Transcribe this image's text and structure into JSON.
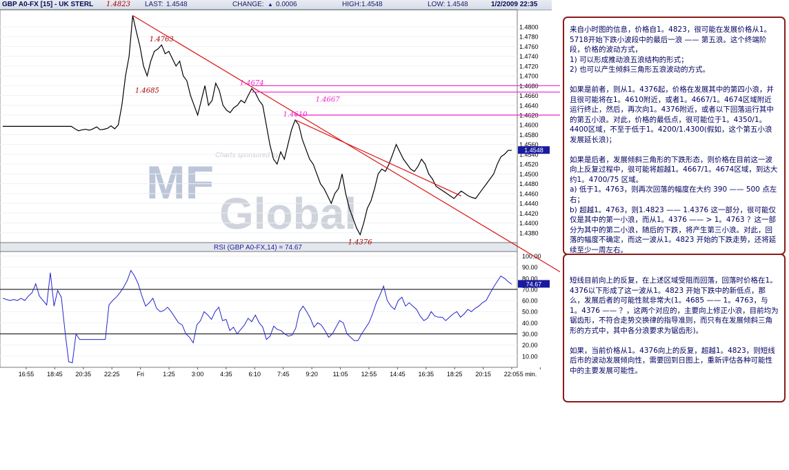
{
  "header": {
    "symbol": "GBP A0-FX [15] - UK STERL",
    "title_high": "1.4823",
    "last_label": "LAST:",
    "last_value": "1.4548",
    "change_label": "CHANGE:",
    "change_arrow": "▲",
    "change_value": "0.0006",
    "high_label": "HIGH:",
    "high_value": "1.4548",
    "low_label": "LOW:",
    "low_value": "1.4548",
    "datetime": "1/2/2009 22:35"
  },
  "colors": {
    "price": "#000000",
    "rsi": "#2222cc",
    "trendline": "#dd1111",
    "resistance": "#ee22cc",
    "annotation_red": "#aa0000",
    "annotation_magenta": "#ee22cc",
    "last_tag_bg": "#1a1aa0",
    "note_border": "#8b1a1a",
    "note_text": "#000060"
  },
  "watermark": {
    "sponsor": "Charts sponsored by",
    "logo_mf": "MF",
    "logo_global": "Global"
  },
  "chart_data": [
    {
      "type": "line",
      "panel": "price",
      "ylim": [
        1.436,
        1.4835
      ],
      "y_ticks": [
        "1.4800",
        "1.4780",
        "1.4760",
        "1.4740",
        "1.4720",
        "1.4700",
        "1.4680",
        "1.4660",
        "1.4640",
        "1.4620",
        "1.4600",
        "1.4580",
        "1.4560",
        "1.4540",
        "1.4520",
        "1.4500",
        "1.4480",
        "1.4460",
        "1.4440",
        "1.4420",
        "1.4400",
        "1.4380"
      ],
      "x_ticks": [
        "16:55",
        "18:45",
        "20:35",
        "22:25",
        "Fri",
        "1:25",
        "3:00",
        "4:35",
        "6:10",
        "7:45",
        "9:20",
        "11:05",
        "12:55",
        "14:45",
        "16:35",
        "18:25",
        "20:15",
        "22:05",
        "5 min."
      ],
      "last_price": "1.4548",
      "series": [
        {
          "values": [
            1.4597,
            1.4597,
            1.4597,
            1.4597,
            1.4597,
            1.4597,
            1.4597,
            1.4597,
            1.4597,
            1.4597,
            1.4597,
            1.4597,
            1.4597,
            1.4597,
            1.4597,
            1.4597,
            1.4597,
            1.4597,
            1.4597,
            1.4597,
            1.4592,
            1.4588,
            1.459,
            1.4591,
            1.4589,
            1.4592,
            1.4596,
            1.459,
            1.4591,
            1.4593,
            1.4598,
            1.4592,
            1.46,
            1.464,
            1.47,
            1.474,
            1.4823,
            1.479,
            1.476,
            1.472,
            1.47,
            1.473,
            1.475,
            1.4755,
            1.4763,
            1.4745,
            1.475,
            1.4735,
            1.472,
            1.473,
            1.47,
            1.469,
            1.466,
            1.464,
            1.462,
            1.465,
            1.468,
            1.464,
            1.465,
            1.4685,
            1.467,
            1.464,
            1.463,
            1.4625,
            1.4635,
            1.464,
            1.465,
            1.4645,
            1.466,
            1.4674,
            1.4665,
            1.465,
            1.464,
            1.46,
            1.456,
            1.453,
            1.452,
            1.4545,
            1.453,
            1.456,
            1.459,
            1.461,
            1.46,
            1.457,
            1.455,
            1.453,
            1.452,
            1.45,
            1.448,
            1.447,
            1.4455,
            1.444,
            1.446,
            1.447,
            1.45,
            1.446,
            1.443,
            1.441,
            1.439,
            1.4376,
            1.44,
            1.443,
            1.4445,
            1.447,
            1.45,
            1.451,
            1.4505,
            1.452,
            1.454,
            1.456,
            1.4545,
            1.453,
            1.452,
            1.451,
            1.4505,
            1.4515,
            1.453,
            1.452,
            1.45,
            1.449,
            1.4475,
            1.447,
            1.4465,
            1.446,
            1.4455,
            1.445,
            1.4458,
            1.4465,
            1.446,
            1.4455,
            1.4452,
            1.445,
            1.446,
            1.447,
            1.448,
            1.449,
            1.45,
            1.452,
            1.4535,
            1.454,
            1.4548,
            1.4548
          ],
          "name": ""
        }
      ],
      "annotations": [
        {
          "text": "1.4823",
          "x_index": 36,
          "y": 1.4823,
          "color": "red"
        },
        {
          "text": "1.4763",
          "x_index": 44,
          "y": 1.4763,
          "color": "red"
        },
        {
          "text": "1.4685",
          "x_index": 40,
          "y": 1.4685,
          "color": "red"
        },
        {
          "text": "1.4674",
          "x_index": 69,
          "y": 1.4674,
          "color": "magenta"
        },
        {
          "text": "1.4667",
          "x_index": 90,
          "y": 1.4667,
          "color": "magenta"
        },
        {
          "text": "1.4610",
          "x_index": 81,
          "y": 1.461,
          "color": "magenta"
        },
        {
          "text": "1.4376",
          "x_index": 99,
          "y": 1.4376,
          "color": "red"
        }
      ],
      "trendlines": [
        {
          "from_index": 36,
          "from_y": 1.4823,
          "to": "note-2",
          "color": "red"
        },
        {
          "from_index": 81,
          "from_y": 1.461,
          "to_index": 127,
          "to_y": 1.4455,
          "color": "red"
        }
      ],
      "horizontal_lines": [
        {
          "y": 1.468,
          "from_index": 69,
          "color": "magenta"
        },
        {
          "y": 1.4667,
          "from_index": 69,
          "color": "magenta"
        },
        {
          "y": 1.462,
          "from_index": 81,
          "color": "magenta"
        }
      ]
    },
    {
      "type": "line",
      "panel": "rsi",
      "title": "RSI (GBP A0-FX,14) = 74.67",
      "ylim": [
        0,
        104
      ],
      "y_ticks": [
        "100.00",
        "90.00",
        "80.00",
        "70.00",
        "60.00",
        "50.00",
        "40.00",
        "30.00",
        "20.00",
        "10.00"
      ],
      "reference_lines": [
        70,
        30
      ],
      "last_value": "74.67",
      "series": [
        {
          "values": [
            62,
            61,
            60,
            61,
            60,
            62,
            60,
            64,
            67,
            75,
            64,
            60,
            56,
            85,
            55,
            69,
            63,
            32,
            5,
            4,
            30,
            25,
            25,
            25,
            25,
            25,
            25,
            25,
            25,
            56,
            60,
            63,
            67,
            72,
            78,
            87,
            82,
            75,
            64,
            55,
            58,
            62,
            53,
            50,
            51,
            54,
            50,
            45,
            40,
            38,
            30,
            27,
            22,
            38,
            42,
            50,
            47,
            43,
            50,
            54,
            42,
            43,
            33,
            36,
            30,
            34,
            38,
            44,
            41,
            47,
            40,
            36,
            25,
            28,
            37,
            34,
            33,
            30,
            28,
            29,
            35,
            50,
            55,
            50,
            44,
            36,
            40,
            38,
            33,
            27,
            30,
            36,
            42,
            40,
            30,
            27,
            24,
            24,
            30,
            35,
            40,
            48,
            58,
            65,
            73,
            60,
            55,
            52,
            60,
            63,
            55,
            58,
            55,
            52,
            46,
            42,
            44,
            50,
            46,
            45,
            45,
            42,
            45,
            48,
            50,
            45,
            48,
            52,
            50,
            53,
            55,
            58,
            60,
            66,
            72,
            77,
            82,
            80,
            77,
            74.67
          ],
          "name": ""
        }
      ]
    }
  ],
  "notes": [
    {
      "paragraphs": [
        "来自小时图的信息，价格自1。4823，很可能在发展价格从1。5718开始下跌小波段中的最后一浪 —— 第五浪。这个终端阶段，价格的波动方式，",
        "1) 可以形成推动浪五浪结构的形式；",
        "2) 也可以产生倾斜三角形五浪波动的方式。",
        "",
        "如果是前者，则从1。4376起，价格在发展其中的第四小浪，并且很可能将在1。4610附近，或者1。4667/1。4674区域附近运行终止，然后，再次向1。4376附近，或者以下回落运行其中的第五小浪。对此，价格的最低点，很可能位于1。4350/1。4400区域，不至于低于1。4200/1.4300(假如，这个第五小浪发展延长浪)；",
        "",
        "如果是后者，发展倾斜三角形的下跌形态，则价格在目前这一波向上反复过程中，很可能将超越1。4667/1。4674区域，到达大约1。4700/75 区域。",
        "a) 低于1。4763，则再次回落的幅度在大约 390 —— 500 点左右；",
        "b) 超越1。4763，则1.4823 —— 1.4376 这一部分，很可能仅仅是其中的第一小浪，而从1。4376 —— > 1。4763 ？这一部分为其中的第二小浪，随后的下跌，将产生第三小浪。对此，回落的幅度不确定，而这一波从1。4823 开始的下跌走势，还将延续至少一周左右。"
      ]
    },
    {
      "paragraphs": [
        "短线目前向上的反复，在上述区域受阻而回落，回落时价格在1。4376以下形成了这一波从1。4823 开始下跌中的新低点，那么，发展后者的可能性就非常大(1。4685 —— 1。4763，与 1。4376 —— ？，这两个对应的，主要向上修正小浪，目前均为锯齿形，不符合走势交换律的指导准则，而只有在发展倾斜三角形的方式中，其中各分浪要求为锯齿形)。",
        "",
        "如果，当前价格从1。4376向上的反复，超越1。4823，则短线后市的波动发展倾向性，需要回到日图上，重新评估各种可能性中的主要发展可能性。"
      ]
    }
  ]
}
